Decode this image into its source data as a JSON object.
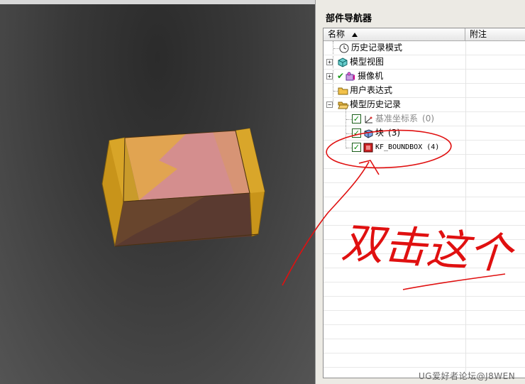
{
  "panel": {
    "title": "部件导航器",
    "columns": {
      "name": "名称",
      "note": "附注"
    }
  },
  "tree": {
    "items": [
      {
        "label": "历史记录模式",
        "icon": "clock-icon"
      },
      {
        "label": "模型视图",
        "icon": "cube-view-icon",
        "expander": "+"
      },
      {
        "label": "摄像机",
        "icon": "camera-icon",
        "expander": "+",
        "checkmark": "✔"
      },
      {
        "label": "用户表达式",
        "icon": "folder-icon"
      },
      {
        "label": "模型历史记录",
        "icon": "folder-open-icon",
        "expander": "−"
      },
      {
        "label": "基准坐标系",
        "count": "(0)",
        "icon": "datum-csys-icon",
        "checked": true
      },
      {
        "label": "块",
        "count": "(3)",
        "icon": "block-icon",
        "checked": true
      },
      {
        "label": "KF_BOUNDBOX",
        "count": "(4)",
        "icon": "kf-feature-icon",
        "checked": true
      }
    ]
  },
  "annotation": {
    "handwritten_text": "双击这个"
  },
  "watermark": "UG爱好者论坛@J8WEN",
  "colors": {
    "annotation_red": "#e01010",
    "box_orange": "#e0a020",
    "box_pink": "#d89090"
  }
}
